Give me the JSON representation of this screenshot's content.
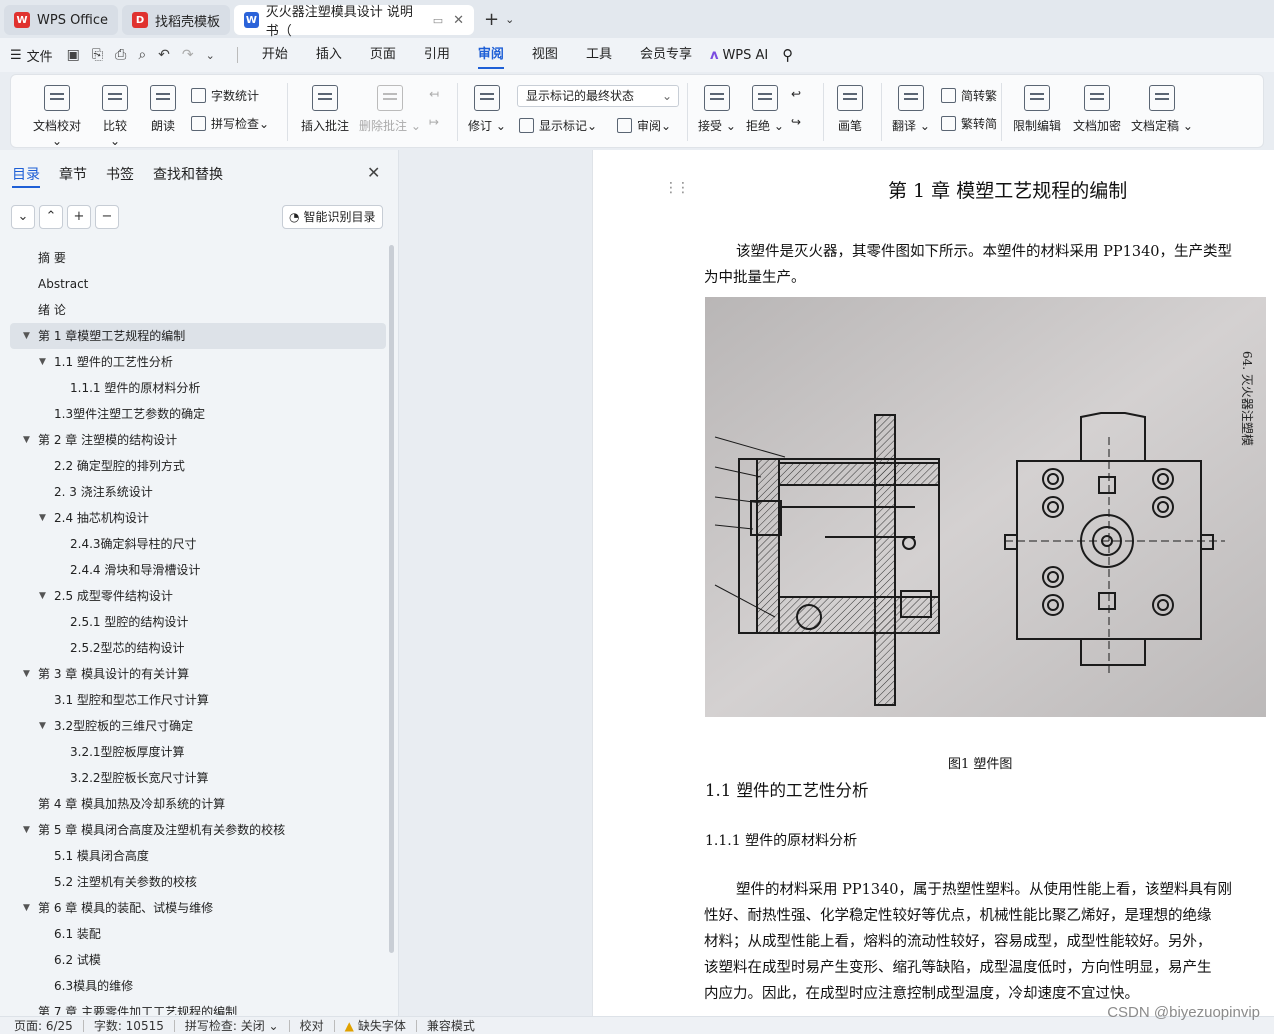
{
  "tabs": [
    {
      "label": "WPS Office",
      "logo": "W",
      "color": "#e0322f"
    },
    {
      "label": "找稻壳模板",
      "logo": "D",
      "color": "#e0322f"
    },
    {
      "label": "灭火器注塑模具设计 说明书（",
      "logo": "W",
      "color": "#2b63d9"
    }
  ],
  "menubar": {
    "file": "文件",
    "tabs": [
      "开始",
      "插入",
      "页面",
      "引用",
      "审阅",
      "视图",
      "工具",
      "会员专享"
    ],
    "active_tab": "审阅",
    "wps_ai": "WPS AI"
  },
  "ribbon": {
    "doc_check": "文档校对",
    "compare": "比较",
    "read_aloud": "朗读",
    "word_count": "字数统计",
    "spell_check": "拼写检查",
    "insert_comment": "插入批注",
    "delete_comment": "删除批注",
    "revise": "修订",
    "markup_state": "显示标记的最终状态",
    "show_markup": "显示标记",
    "review": "审阅",
    "accept": "接受",
    "reject": "拒绝",
    "ink": "画笔",
    "translate": "翻译",
    "to_traditional": "简转繁",
    "to_simplified": "繁转简",
    "restrict_edit": "限制编辑",
    "encrypt": "文档加密",
    "finalize": "文档定稿"
  },
  "nav": {
    "tabs": [
      "目录",
      "章节",
      "书签",
      "查找和替换"
    ],
    "active_tab": "目录",
    "smart_button": "智能识别目录",
    "toc": [
      {
        "label": "摘  要",
        "level": 0,
        "arrow": false
      },
      {
        "label": "Abstract",
        "level": 0,
        "arrow": false
      },
      {
        "label": "绪  论",
        "level": 0,
        "arrow": false
      },
      {
        "label": "第 1 章模塑工艺规程的编制",
        "level": 0,
        "arrow": true,
        "active": true
      },
      {
        "label": "1.1  塑件的工艺性分析",
        "level": 1,
        "arrow": true
      },
      {
        "label": "1.1.1    塑件的原材料分析",
        "level": 2,
        "arrow": false
      },
      {
        "label": "1.3塑件注塑工艺参数的确定",
        "level": 1,
        "arrow": false
      },
      {
        "label": "第 2 章  注塑模的结构设计",
        "level": 0,
        "arrow": true
      },
      {
        "label": "2.2  确定型腔的排列方式",
        "level": 1,
        "arrow": false
      },
      {
        "label": "2. 3  浇注系统设计",
        "level": 1,
        "arrow": false
      },
      {
        "label": "2.4  抽芯机构设计",
        "level": 1,
        "arrow": true
      },
      {
        "label": "2.4.3确定斜导柱的尺寸",
        "level": 2,
        "arrow": false
      },
      {
        "label": "2.4.4  滑块和导滑槽设计",
        "level": 2,
        "arrow": false
      },
      {
        "label": "2.5  成型零件结构设计",
        "level": 1,
        "arrow": true
      },
      {
        "label": "2.5.1  型腔的结构设计",
        "level": 2,
        "arrow": false
      },
      {
        "label": "2.5.2型芯的结构设计",
        "level": 2,
        "arrow": false
      },
      {
        "label": "第 3 章  模具设计的有关计算",
        "level": 0,
        "arrow": true
      },
      {
        "label": "3.1  型腔和型芯工作尺寸计算",
        "level": 1,
        "arrow": false
      },
      {
        "label": "3.2型腔板的三维尺寸确定",
        "level": 1,
        "arrow": true
      },
      {
        "label": "3.2.1型腔板厚度计算",
        "level": 2,
        "arrow": false
      },
      {
        "label": "3.2.2型腔板长宽尺寸计算",
        "level": 2,
        "arrow": false
      },
      {
        "label": "第 4 章  模具加热及冷却系统的计算",
        "level": 0,
        "arrow": false
      },
      {
        "label": "第 5 章  模具闭合高度及注塑机有关参数的校核",
        "level": 0,
        "arrow": true
      },
      {
        "label": "5.1  模具闭合高度",
        "level": 1,
        "arrow": false
      },
      {
        "label": "5.2  注塑机有关参数的校核",
        "level": 1,
        "arrow": false
      },
      {
        "label": "第 6 章  模具的装配、试模与维修",
        "level": 0,
        "arrow": true
      },
      {
        "label": "6.1  装配",
        "level": 1,
        "arrow": false
      },
      {
        "label": "6.2  试模",
        "level": 1,
        "arrow": false
      },
      {
        "label": "6.3模具的维修",
        "level": 1,
        "arrow": false
      },
      {
        "label": "第 7 章  主要零件加工工艺规程的编制",
        "level": 0,
        "arrow": false
      }
    ]
  },
  "document": {
    "chapter_title": "第 1 章  模塑工艺规程的编制",
    "intro_line1": "该塑件是灭火器，其零件图如下所示。本塑件的材料采用 PP1340，生产类型",
    "intro_line2": "为中批量生产。",
    "figure_side_text": "64. 灭火器注塑模",
    "figure_caption": "图1   塑件图",
    "section_title": "1.1  塑件的工艺性分析",
    "subsection_title": "1.1.1    塑件的原材料分析",
    "body": [
      "塑件的材料采用 PP1340，属于热塑性塑料。从使用性能上看，该塑料具有刚",
      "性好、耐热性强、化学稳定性较好等优点，机械性能比聚乙烯好，是理想的绝缘",
      "材料；从成型性能上看，熔料的流动性较好，容易成型，成型性能较好。另外，",
      "该塑料在成型时易产生变形、缩孔等缺陷，成型温度低时，方向性明显，易产生",
      "内应力。因此，在成型时应注意控制成型温度，冷却速度不宜过快。"
    ]
  },
  "status": {
    "page": "页面: 6/25",
    "words": "字数: 10515",
    "spell": "拼写检查: 关闭",
    "proof": "校对",
    "missing_font": "缺失字体",
    "compat": "兼容模式"
  },
  "watermark": "CSDN @biyezuopinvip"
}
